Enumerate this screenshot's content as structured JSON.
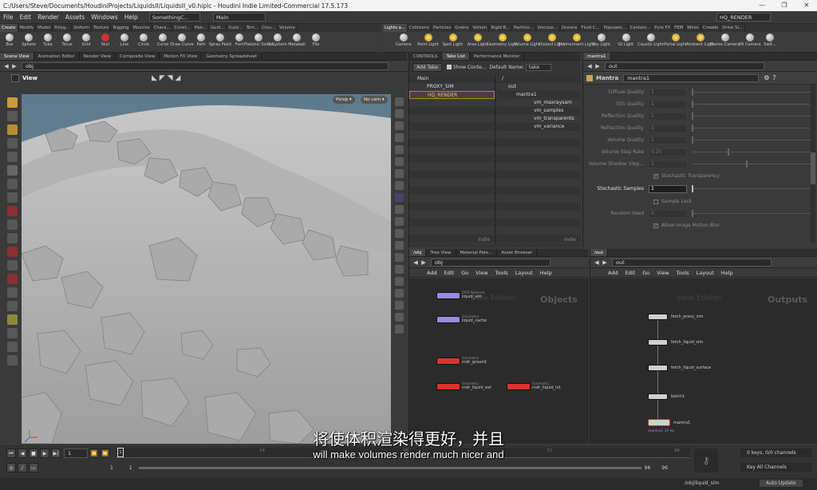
{
  "window": {
    "title": "C:/Users/Steve/Documents/HoudiniProjects/LiquidsII/LiquidsII_v0.hiplc - Houdini Indie Limited-Commercial 17.5.173",
    "controls": [
      "—",
      "❐",
      "✕"
    ]
  },
  "menubar": {
    "items": [
      "File",
      "Edit",
      "Render",
      "Assets",
      "Windows",
      "Help"
    ],
    "desktop": "SomethingC...",
    "network": "Main",
    "take": "HQ_RENDER"
  },
  "shelf_left": {
    "tabs": [
      "Create",
      "Modify",
      "Model",
      "Polyg...",
      "Deform",
      "Texture",
      "Rigging",
      "Muscles",
      "Chara...",
      "Const...",
      "Hair...",
      "Guid...",
      "Guid...",
      "Terr...",
      "Clou...",
      "Volume"
    ],
    "tools": [
      "Box",
      "Sphere",
      "Tube",
      "Torus",
      "Grid",
      "Null",
      "Line",
      "Circle",
      "Curve",
      "Draw Curve",
      "Path",
      "Spray Paint",
      "Font",
      "Platonic Solids",
      "L-System",
      "Metaball",
      "File"
    ]
  },
  "shelf_right": {
    "tabs": [
      "Lights a...",
      "Collisions",
      "Particles",
      "Grains",
      "Vellum",
      "Rigid B...",
      "Particle...",
      "Viscous...",
      "Oceans",
      "Fluid C...",
      "Populate...",
      "Contain...",
      "Pyro FX",
      "FEM",
      "Wires",
      "Crowds",
      "Drive Si..."
    ],
    "tools": [
      "Camera",
      "Point Light",
      "Spot Light",
      "Area Light",
      "Geometry Light",
      "Volume Light",
      "Distant Light",
      "Environment Light",
      "Sky Light",
      "GI Light",
      "Caustic Light",
      "Portal Light",
      "Ambient Light",
      "Stereo Camera",
      "VR Camera",
      "Swit..."
    ]
  },
  "scene": {
    "tabs": [
      "Scene View",
      "Animation Editor",
      "Render View",
      "Composite View",
      "Motion FX View",
      "Geometry Spreadsheet"
    ],
    "path": "obj",
    "view_label": "View",
    "persp": "Persp ▾",
    "cam": "No cam ▾"
  },
  "takes": {
    "tabs": [
      "CONTROLS",
      "Take List",
      "Performance Monitor"
    ],
    "add_take": "Add Take",
    "show_contents": "Show Conte...",
    "default_name_label": "Default Name:",
    "default_name": "take",
    "list": [
      "Main",
      "PROXY_SIM",
      "HQ_RENDER"
    ],
    "tree": [
      "/",
      "out",
      "mantra1",
      "vm_maxraysam",
      "vm_samples",
      "vm_transparents",
      "vm_variance"
    ],
    "watermark": "Indie"
  },
  "params": {
    "tab": "mantra1",
    "path": "out",
    "node_type": "Mantra",
    "node_name": "mantra1",
    "rows": [
      {
        "label": "Diffuse Quality",
        "value": "1"
      },
      {
        "label": "SSS Quality",
        "value": "1"
      },
      {
        "label": "Reflection Quality",
        "value": "1"
      },
      {
        "label": "Refraction Quality",
        "value": "1"
      },
      {
        "label": "Volume Quality",
        "value": "1"
      },
      {
        "label": "Volume Step Rate",
        "value": "0.25"
      },
      {
        "label": "Volume Shadow Step...",
        "value": "1"
      }
    ],
    "stochastic_transparency": "Stochastic Transparency",
    "stochastic_samples_label": "Stochastic Samples",
    "stochastic_samples": "1",
    "sample_lock": "Sample Lock",
    "random_seed_label": "Random Seed",
    "random_seed": "0",
    "motion_blur": "Allow Image Motion Blur"
  },
  "network_obj": {
    "tabs": [
      "/obj",
      "Tree View",
      "Material Pale...",
      "Asset Browser"
    ],
    "path": "obj",
    "menu": [
      "Add",
      "Edit",
      "Go",
      "View",
      "Tools",
      "Layout",
      "Help"
    ],
    "watermark": "Indie Edition",
    "context": "Objects",
    "nodes": [
      {
        "type": "DOP Network",
        "name": "liquid_sim"
      },
      {
        "type": "Geometry",
        "name": "liquid_cache"
      },
      {
        "type": "Geometry",
        "name": "rndr_ground"
      },
      {
        "type": "Geometry",
        "name": "rndr_liquid_ext"
      },
      {
        "type": "Geometry",
        "name": "rndr_liquid_int"
      }
    ]
  },
  "network_out": {
    "tabs": [
      "/out"
    ],
    "path": "out",
    "menu": [
      "Add",
      "Edit",
      "Go",
      "View",
      "Tools",
      "Layout",
      "Help"
    ],
    "watermark": "Indie Edition",
    "context": "Outputs",
    "nodes": [
      "fetch_proxy_sim",
      "fetch_liquid_sim",
      "fetch_liquid_surface",
      "batch1",
      "mantra1"
    ],
    "node_sub": "mantra1 1F-ex"
  },
  "timeline": {
    "frame": "1",
    "start": "1",
    "end": "96",
    "end2": "96",
    "range_start": "1",
    "range_start2": "1",
    "keys": "0 keys, 0/0 channels",
    "key_all": "Key All Channels",
    "status_path": "/obj/liquid_sim",
    "auto_update": "Auto Update",
    "ticks": [
      "24",
      "48",
      "72",
      "96"
    ]
  },
  "subtitle": {
    "chinese": "将使体积渲染得更好，并且",
    "english": "will make volumes render much nicer and"
  }
}
